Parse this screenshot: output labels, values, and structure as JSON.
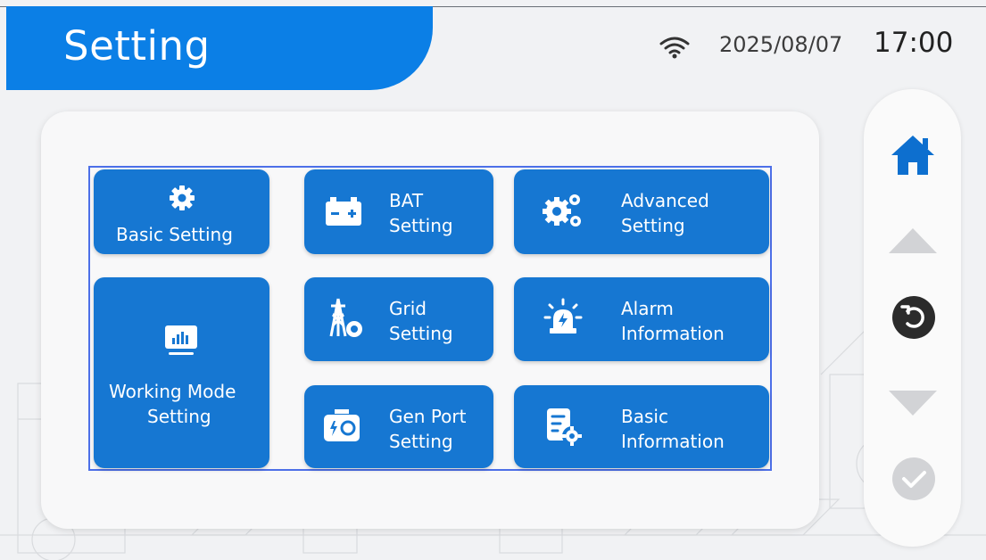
{
  "header": {
    "title": "Setting",
    "date": "2025/08/07",
    "time": "17:00",
    "wifi_icon": "wifi-icon"
  },
  "menu": {
    "basic_setting": "Basic Setting",
    "working_mode_line1": "Working Mode",
    "working_mode_line2": "Setting",
    "bat_line1": "BAT",
    "bat_line2": "Setting",
    "grid_line1": "Grid",
    "grid_line2": "Setting",
    "genport_line1": "Gen Port",
    "genport_line2": "Setting",
    "advanced_line1": "Advanced",
    "advanced_line2": "Setting",
    "alarm_line1": "Alarm",
    "alarm_line2": "Information",
    "basicinfo_line1": "Basic",
    "basicinfo_line2": "Information"
  },
  "sidebar": {
    "icons": [
      "home-icon",
      "arrow-up-icon",
      "back-icon",
      "arrow-down-icon",
      "confirm-icon"
    ]
  },
  "colors": {
    "accent": "#0b7fe6",
    "tile": "#1677d2",
    "home": "#0d6fcf",
    "disabled": "#d2d3d6",
    "back": "#2b2b2b"
  }
}
